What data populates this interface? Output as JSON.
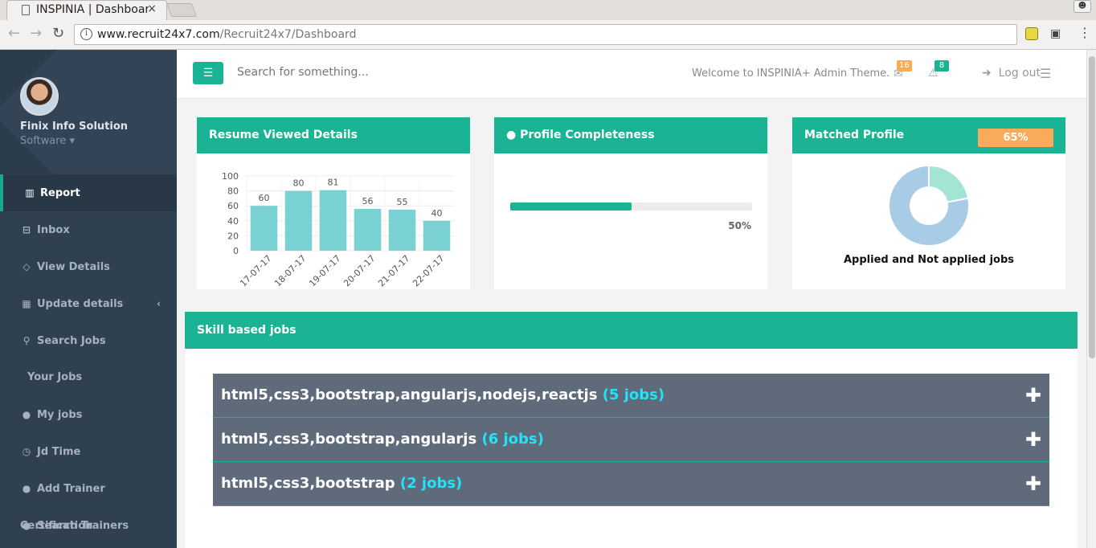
{
  "browser": {
    "tab_title": "INSPINIA | Dashboard",
    "tab_close": "×",
    "url_host": "www.recruit24x7.com",
    "url_path": "/Recruit24x7/Dashboard"
  },
  "sidebar": {
    "org_name": "Finix Info Solution",
    "role": "Software ▾",
    "items": [
      {
        "label": "Report",
        "icon": "bar-chart-icon",
        "glyph": "▥",
        "active": true
      },
      {
        "label": "Inbox",
        "icon": "inbox-icon",
        "glyph": "⊟"
      },
      {
        "label": "View Details",
        "icon": "diamond-icon",
        "glyph": "◇"
      },
      {
        "label": "Update details",
        "icon": "grid-icon",
        "glyph": "▦",
        "caret": "‹"
      },
      {
        "label": "Search Jobs",
        "icon": "search-icon",
        "glyph": "⚲"
      },
      {
        "label": "Your Jobs",
        "icon": "",
        "glyph": ""
      },
      {
        "label": "My jobs",
        "icon": "user-icon",
        "glyph": "●"
      },
      {
        "label": "Jd Time",
        "icon": "clock-icon",
        "glyph": "◷"
      },
      {
        "label": "Add Trainer Certification",
        "icon": "user-icon",
        "glyph": "●"
      },
      {
        "label": "Search Trainers",
        "icon": "user-icon",
        "glyph": "●"
      }
    ]
  },
  "topnav": {
    "search_placeholder": "Search for something...",
    "welcome": "Welcome to INSPINIA+ Admin Theme.",
    "mail_count": "16",
    "alert_count": "8",
    "logout": "Log out"
  },
  "widgets": {
    "resume": {
      "title": "Resume Viewed Details"
    },
    "profile": {
      "title": "Profile Completeness",
      "progress": 0.5,
      "progress_label": "50%"
    },
    "matched": {
      "title": "Matched Profile",
      "badge": "65%",
      "caption": "Applied and Not applied jobs"
    }
  },
  "chart_data": [
    {
      "type": "bar",
      "categories": [
        "17-07-17",
        "18-07-17",
        "19-07-17",
        "20-07-17",
        "21-07-17",
        "22-07-17"
      ],
      "values": [
        60,
        80,
        81,
        56,
        55,
        40
      ],
      "ylim": [
        0,
        100
      ],
      "yticks": [
        0,
        20,
        40,
        60,
        80,
        100
      ],
      "color": "#7ad1d1",
      "grid": true
    },
    {
      "type": "pie",
      "values": [
        0.22,
        0.78
      ],
      "colors": [
        "#a3e4d5",
        "#a8cce6"
      ],
      "donut": true
    }
  ],
  "skill": {
    "title": "Skill based jobs",
    "jobs": [
      {
        "skills": "html5,css3,bootstrap,angularjs,nodejs,reactjs",
        "count": "(5 jobs)"
      },
      {
        "skills": "html5,css3,bootstrap,angularjs",
        "count": "(6 jobs)"
      },
      {
        "skills": "html5,css3,bootstrap",
        "count": "(2 jobs)"
      }
    ],
    "expand_glyph": "✚"
  },
  "colors": {
    "accent": "#1ab394",
    "sidebar": "#2f4050",
    "warning": "#f8ac59",
    "job_bg": "#5f6b7a",
    "job_count": "#22e3f7"
  }
}
